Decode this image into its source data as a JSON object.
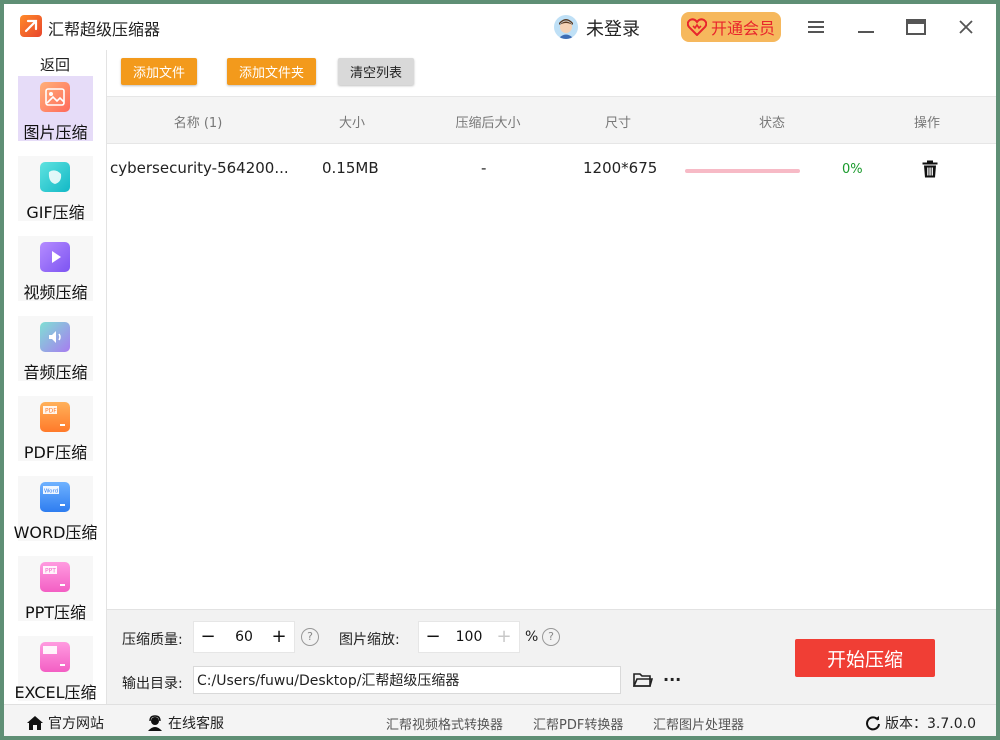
{
  "app": {
    "title": "汇帮超级压缩器"
  },
  "header": {
    "login_text": "未登录",
    "vip_label": "开通会员"
  },
  "sidebar": {
    "back_label": "返回",
    "items": [
      {
        "label": "图片压缩",
        "icon": "image-icon",
        "active": true
      },
      {
        "label": "GIF压缩",
        "icon": "gif-icon"
      },
      {
        "label": "视频压缩",
        "icon": "video-icon"
      },
      {
        "label": "音频压缩",
        "icon": "audio-icon"
      },
      {
        "label": "PDF压缩",
        "icon": "pdf-icon"
      },
      {
        "label": "WORD压缩",
        "icon": "word-icon"
      },
      {
        "label": "PPT压缩",
        "icon": "ppt-icon"
      },
      {
        "label": "EXCEL压缩",
        "icon": "excel-icon"
      }
    ]
  },
  "toolbar": {
    "add_file": "添加文件",
    "add_folder": "添加文件夹",
    "clear_list": "清空列表"
  },
  "table": {
    "columns": [
      "名称 (1)",
      "大小",
      "压缩后大小",
      "尺寸",
      "状态",
      "操作"
    ],
    "rows": [
      {
        "name": "cybersecurity-564200...",
        "size": "0.15MB",
        "compressed_size": "-",
        "dimensions": "1200*675",
        "progress": 0,
        "progress_text": "0%"
      }
    ]
  },
  "settings": {
    "quality_label": "压缩质量:",
    "quality_value": "60",
    "scale_label": "图片缩放:",
    "scale_value": "100",
    "scale_unit": "%",
    "minus": "−",
    "plus": "+",
    "help": "?",
    "output_label": "输出目录:",
    "output_path": "C:/Users/fuwu/Desktop/汇帮超级压缩器",
    "more": "···",
    "start_button": "开始压缩"
  },
  "statusbar": {
    "website": "官方网站",
    "support": "在线客服",
    "links": [
      "汇帮视频格式转换器",
      "汇帮PDF转换器",
      "汇帮图片处理器"
    ],
    "version": "版本：3.7.0.0"
  },
  "colors": {
    "accent": "#f39a1c",
    "start": "#f03e35",
    "active_nav": "#e6dcf8",
    "vip_bg": "#f6b85d"
  }
}
